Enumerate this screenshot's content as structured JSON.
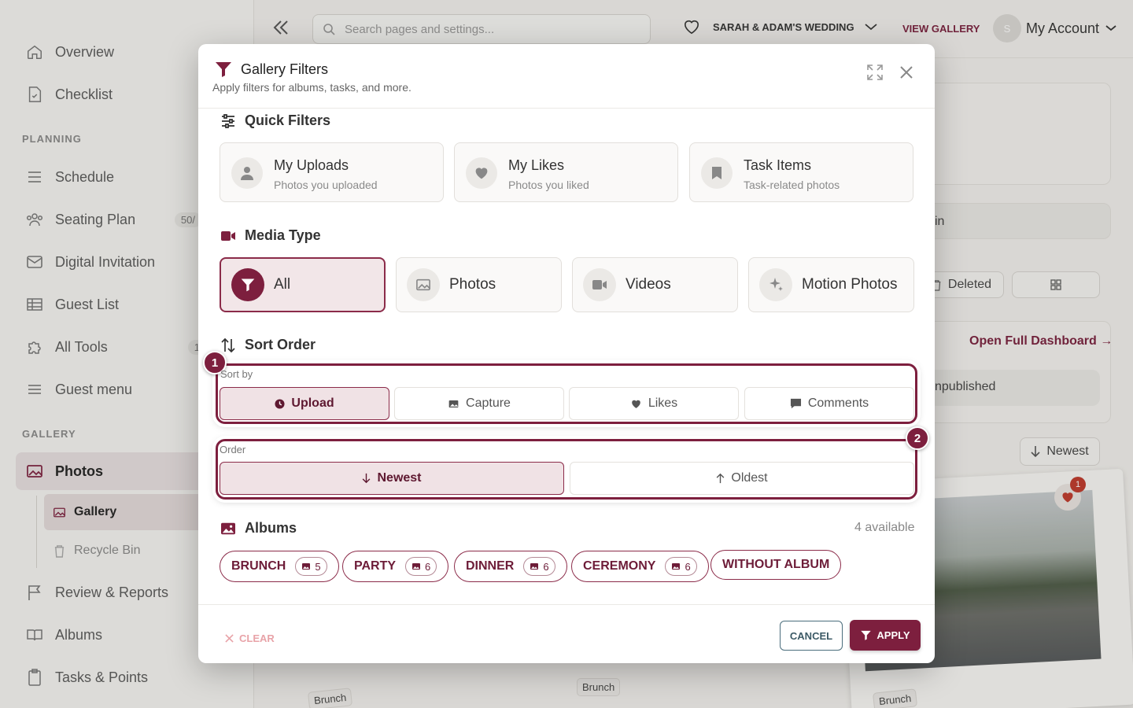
{
  "sidebar": {
    "items": [
      {
        "label": "Overview",
        "icon": "home-icon"
      },
      {
        "label": "Checklist",
        "icon": "document-icon"
      }
    ],
    "planning_title": "PLANNING",
    "planning": [
      {
        "label": "Schedule"
      },
      {
        "label": "Seating Plan",
        "badge": "50/"
      },
      {
        "label": "Digital Invitation"
      },
      {
        "label": "Guest List"
      },
      {
        "label": "All Tools",
        "badge": "1"
      },
      {
        "label": "Guest menu"
      }
    ],
    "gallery_title": "GALLERY",
    "photos_label": "Photos",
    "gallery_sub": "Gallery",
    "recycle_sub": "Recycle Bin",
    "bottom": [
      {
        "label": "Review & Reports"
      },
      {
        "label": "Albums"
      },
      {
        "label": "Tasks & Points"
      }
    ]
  },
  "topbar": {
    "search_placeholder": "Search pages and settings...",
    "wedding_name": "SARAH & ADAM'S WEDDING",
    "view_gallery": "VIEW GALLERY",
    "avatar_initial": "S",
    "account_label": "My Account"
  },
  "background": {
    "in_text": "in",
    "deleted": "Deleted",
    "open_dashboard": "Open Full Dashboard →",
    "unpublished": "npublished",
    "newest": "Newest",
    "photo_likes": "1",
    "brunch_tags": [
      "Brunch",
      "Brunch",
      "Brunch"
    ]
  },
  "modal": {
    "title": "Gallery Filters",
    "subtitle": "Apply filters for albums, tasks, and more.",
    "quick_filters_title": "Quick Filters",
    "quick_filters": [
      {
        "title": "My Uploads",
        "subtitle": "Photos you uploaded"
      },
      {
        "title": "My Likes",
        "subtitle": "Photos you liked"
      },
      {
        "title": "Task Items",
        "subtitle": "Task-related photos"
      }
    ],
    "media_type_title": "Media Type",
    "media_types": [
      {
        "label": "All",
        "selected": true
      },
      {
        "label": "Photos",
        "selected": false
      },
      {
        "label": "Videos",
        "selected": false
      },
      {
        "label": "Motion Photos",
        "selected": false
      }
    ],
    "sort_order_title": "Sort Order",
    "sort_by_label": "Sort by",
    "sort_by": [
      {
        "label": "Upload",
        "selected": true
      },
      {
        "label": "Capture",
        "selected": false
      },
      {
        "label": "Likes",
        "selected": false
      },
      {
        "label": "Comments",
        "selected": false
      }
    ],
    "order_label": "Order",
    "order": [
      {
        "label": "Newest",
        "selected": true
      },
      {
        "label": "Oldest",
        "selected": false
      }
    ],
    "highlight_numbers": [
      "1",
      "2"
    ],
    "albums_title": "Albums",
    "albums_available": "4 available",
    "albums": [
      {
        "name": "BRUNCH",
        "count": "5"
      },
      {
        "name": "PARTY",
        "count": "6"
      },
      {
        "name": "DINNER",
        "count": "6"
      },
      {
        "name": "CEREMONY",
        "count": "6"
      },
      {
        "name": "WITHOUT ALBUM",
        "count": null
      }
    ],
    "clear_label": "CLEAR",
    "cancel_label": "CANCEL",
    "apply_label": "APPLY"
  },
  "colors": {
    "accent": "#7d1f3e",
    "accent_light": "#f0e2e5",
    "cancel_border": "#4a6d7c",
    "clear_text": "#e8a3a8"
  }
}
